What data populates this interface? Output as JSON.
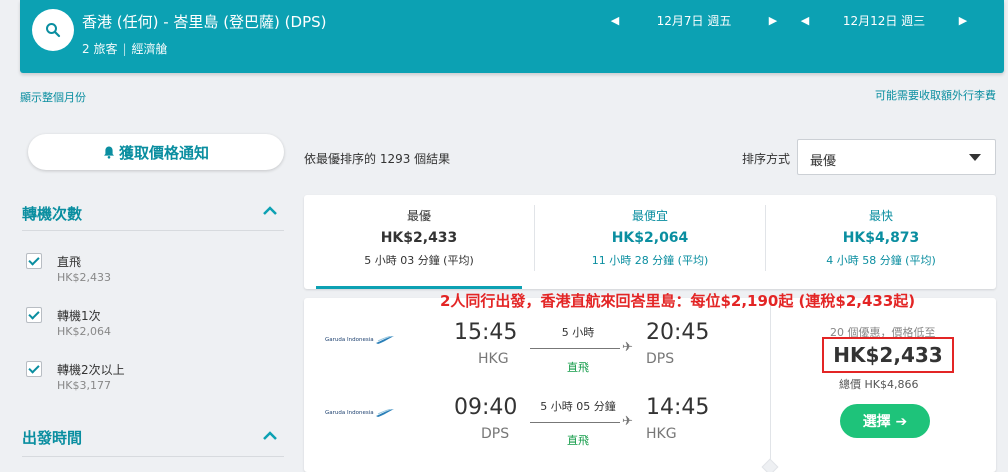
{
  "header": {
    "route": "香港 (任何) - 峇里島 (登巴薩) (DPS)",
    "passengers": "2 旅客",
    "cabin": "經濟艙",
    "depart_date": "12月7日 週五",
    "return_date": "12月12日 週三",
    "prev_arrow": "◀",
    "next_arrow": "▶",
    "icons": [
      "search-icon"
    ]
  },
  "links": {
    "show_month": "顯示整個月份",
    "baggage_fee": "可能需要收取額外行李費"
  },
  "price_alert": {
    "label": "獲取價格通知",
    "icon": "bell-icon"
  },
  "filters": {
    "stops_title": "轉機次數",
    "stops": [
      {
        "label": "直飛",
        "price": "HK$2,433",
        "checked": true
      },
      {
        "label": "轉機1次",
        "price": "HK$2,064",
        "checked": true
      },
      {
        "label": "轉機2次以上",
        "price": "HK$3,177",
        "checked": true
      }
    ],
    "departure_title": "出發時間"
  },
  "results": {
    "count_text": "依最優排序的 1293 個結果",
    "sort_label": "排序方式",
    "sort_value": "最優"
  },
  "sort_tabs": [
    {
      "title": "最優",
      "price": "HK$2,433",
      "duration": "5 小時 03 分鐘 (平均)",
      "active": true
    },
    {
      "title": "最便宜",
      "price": "HK$2,064",
      "duration": "11 小時 28 分鐘 (平均)",
      "active": false
    },
    {
      "title": "最快",
      "price": "HK$4,873",
      "duration": "4 小時 58 分鐘 (平均)",
      "active": false
    }
  ],
  "promo_text": "2人同行出發，香港直航來回峇里島：每位$2,190起 (連稅$2,433起)",
  "flight_card": {
    "legs": [
      {
        "airline": "Garuda Indonesia",
        "depart_time": "15:45",
        "depart_code": "HKG",
        "duration": "5 小時",
        "stops": "直飛",
        "arrive_time": "20:45",
        "arrive_code": "DPS"
      },
      {
        "airline": "Garuda Indonesia",
        "depart_time": "09:40",
        "depart_code": "DPS",
        "duration": "5 小時 05 分鐘",
        "stops": "直飛",
        "arrive_time": "14:45",
        "arrive_code": "HKG"
      }
    ],
    "deal_text": "20 個優惠，價格低至",
    "price": "HK$2,433",
    "total": "總價 HK$4,866",
    "select_label": "選擇 ➔"
  },
  "colors": {
    "brand": "#0ca1b3",
    "link": "#0a8ea0",
    "promo": "#e32525",
    "select_button": "#1ec37a",
    "direct": "#159c4a"
  }
}
